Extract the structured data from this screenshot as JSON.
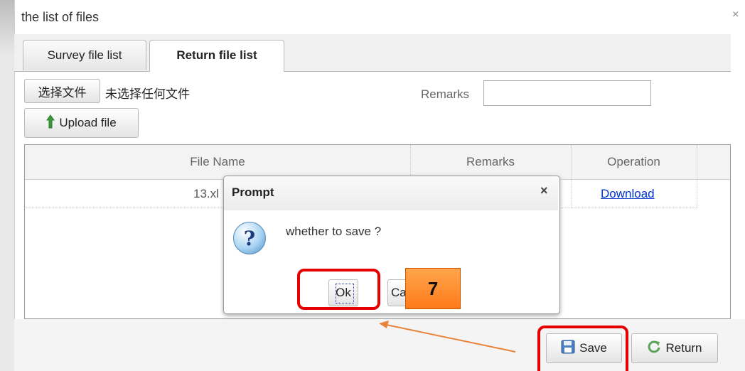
{
  "window": {
    "title": "the list of files",
    "close_glyph": "×"
  },
  "tabs": [
    {
      "label": "Survey file list",
      "active": false
    },
    {
      "label": "Return file list",
      "active": true
    }
  ],
  "upload": {
    "choose_button": "选择文件",
    "no_file_text": "未选择任何文件",
    "upload_button": "Upload file",
    "upload_icon": "up-arrow-icon"
  },
  "remarks": {
    "label": "Remarks",
    "value": ""
  },
  "table": {
    "columns": [
      "File Name",
      "Remarks",
      "Operation"
    ],
    "rows": [
      {
        "file_name": "13.xl",
        "remarks": "",
        "operation": "Download"
      }
    ]
  },
  "dialog": {
    "title": "Prompt",
    "close_glyph": "×",
    "icon": "question-icon",
    "message": "whether to save ?",
    "ok_label": "Ok",
    "cancel_label": "Ca"
  },
  "annotation": {
    "step_number": "7",
    "highlight_color": "#e60000",
    "arrow_color": "#e8843a",
    "badge_color": "#ff8c2e"
  },
  "footer": {
    "save_label": "Save",
    "save_icon": "floppy-disk-icon",
    "return_label": "Return",
    "return_icon": "refresh-icon"
  }
}
